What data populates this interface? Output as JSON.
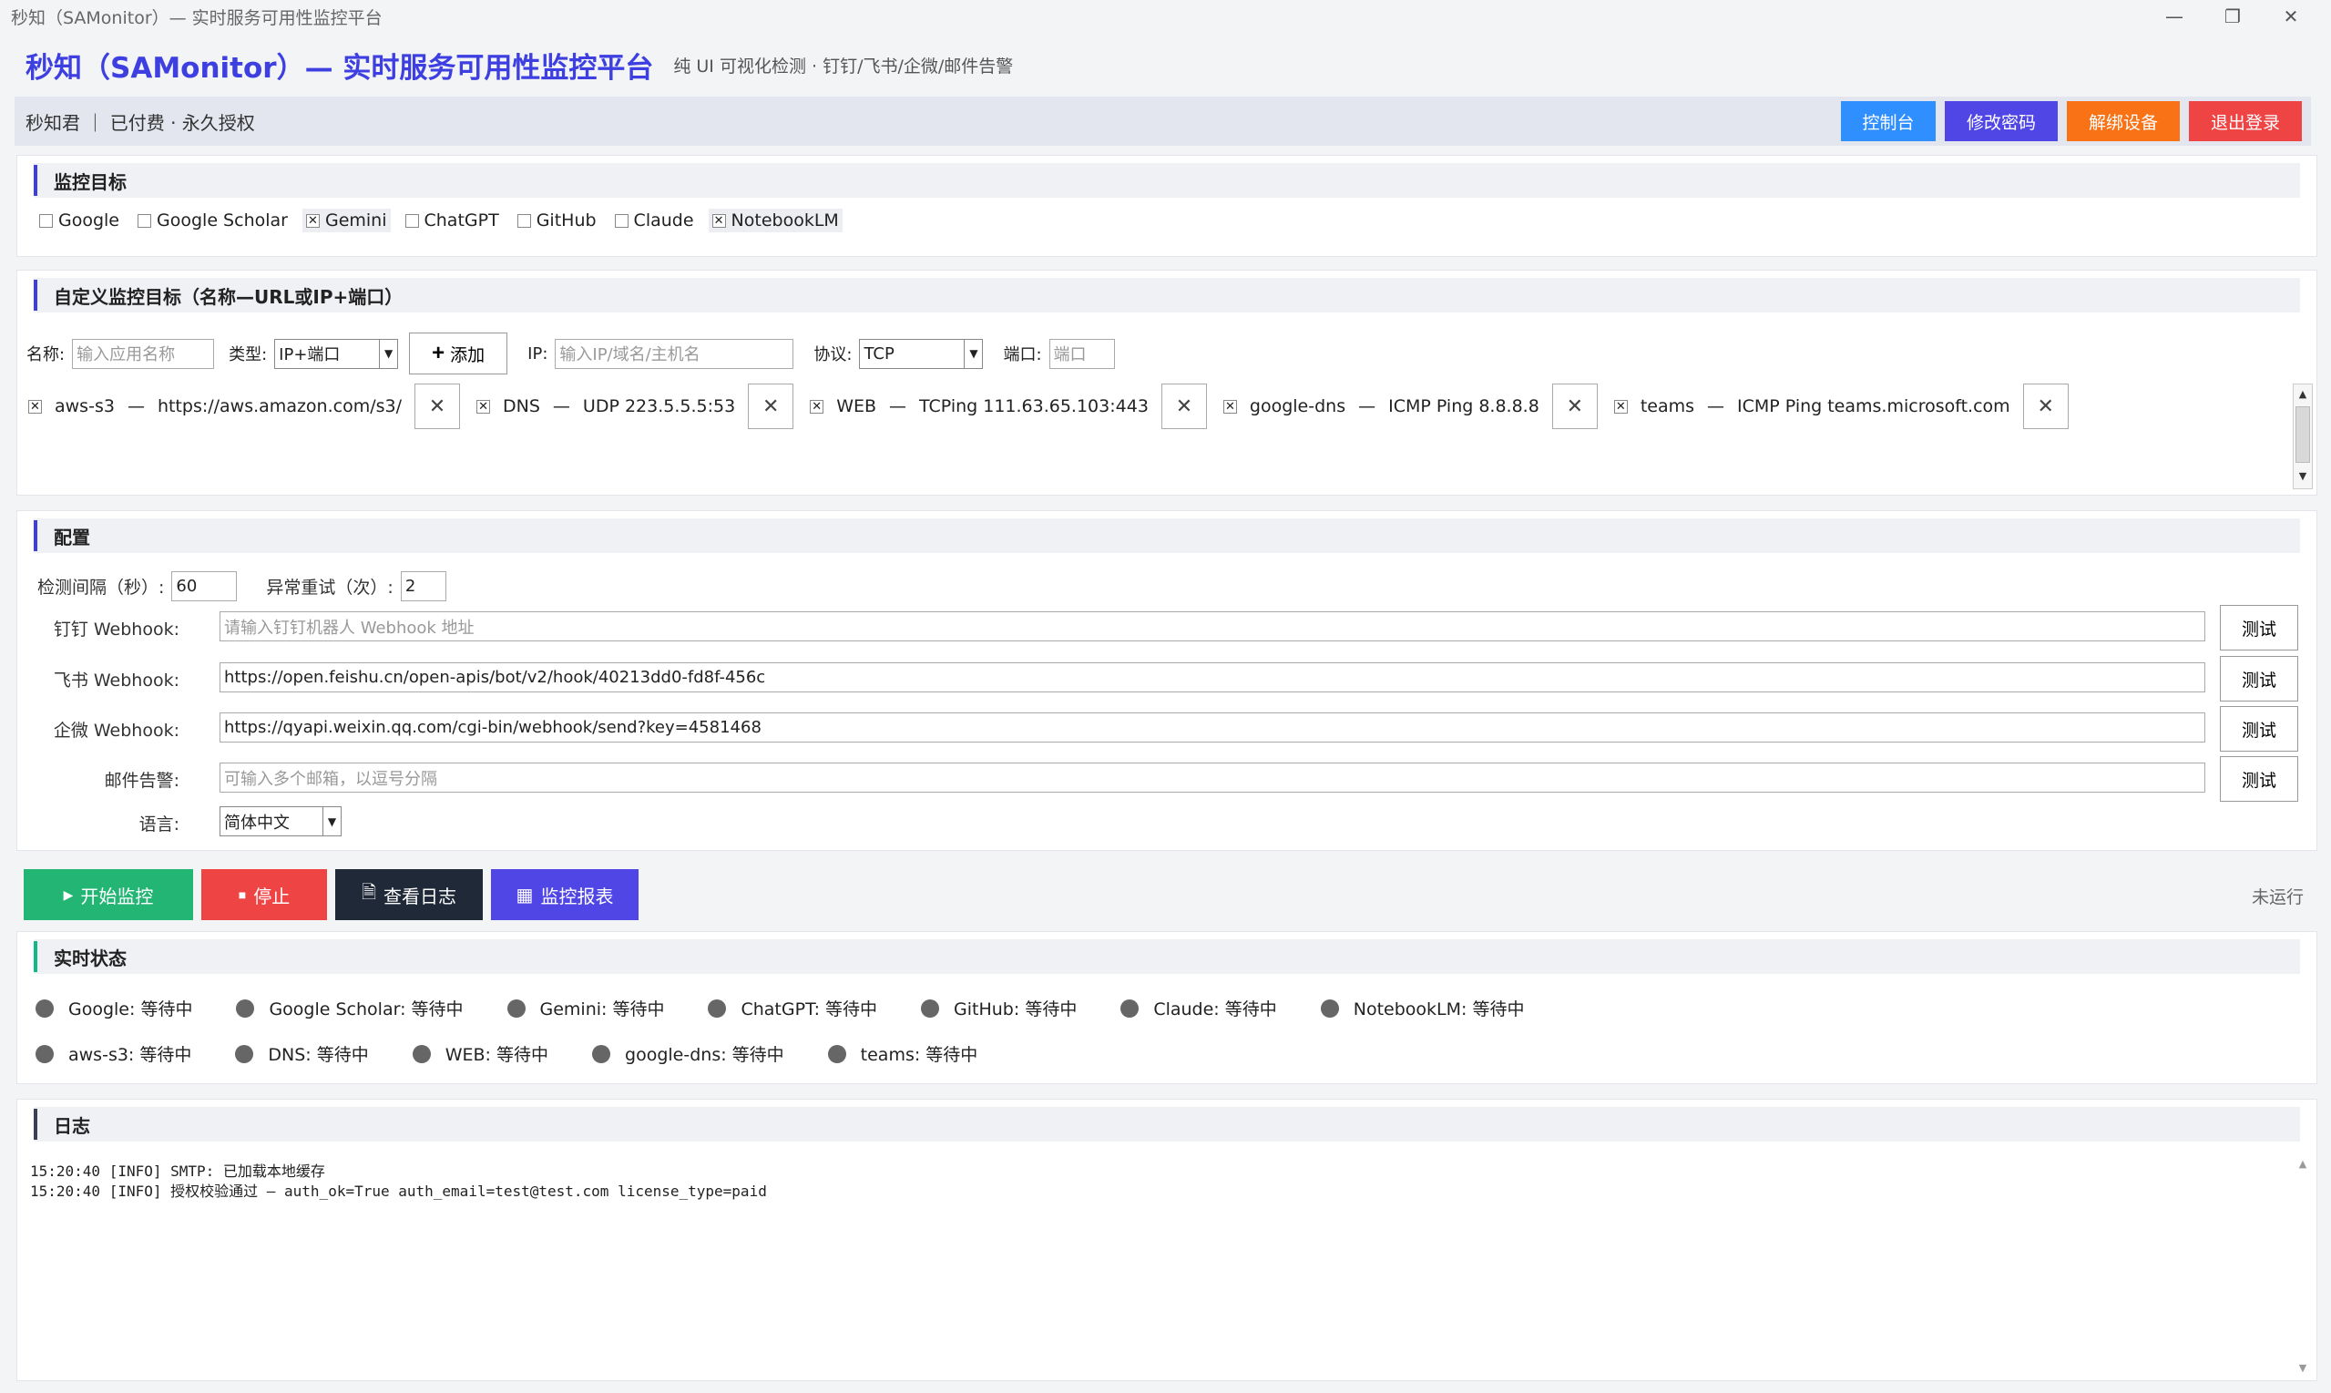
{
  "window": {
    "title": "秒知（SAMonitor）— 实时服务可用性监控平台",
    "controls": [
      "—",
      "❐",
      "✕"
    ]
  },
  "header": {
    "title": "秒知（SAMonitor）— 实时服务可用性监控平台",
    "subtitle": "纯 UI 可视化检测 · 钉钉/飞书/企微/邮件告警"
  },
  "user": {
    "info": "秒知君 ｜ 已付费 · 永久授权",
    "buttons": [
      {
        "label": "控制台",
        "color": "#2f8fff"
      },
      {
        "label": "修改密码",
        "color": "#4f46e5"
      },
      {
        "label": "解绑设备",
        "color": "#f97316"
      },
      {
        "label": "退出登录",
        "color": "#ef4444"
      }
    ]
  },
  "targets": {
    "title": "监控目标",
    "items": [
      {
        "label": "Google",
        "checked": false
      },
      {
        "label": "Google Scholar",
        "checked": false
      },
      {
        "label": "Gemini",
        "checked": true
      },
      {
        "label": "ChatGPT",
        "checked": false
      },
      {
        "label": "GitHub",
        "checked": false
      },
      {
        "label": "Claude",
        "checked": false
      },
      {
        "label": "NotebookLM",
        "checked": true
      }
    ]
  },
  "custom": {
    "title": "自定义监控目标（名称—URL或IP+端口）",
    "name_label": "名称:",
    "name_placeholder": "输入应用名称",
    "type_label": "类型:",
    "type_value": "IP+端口",
    "add_label": "添加",
    "ip_label": "IP:",
    "ip_placeholder": "输入IP/域名/主机名",
    "proto_label": "协议:",
    "proto_value": "TCP",
    "port_label": "端口:",
    "port_placeholder": "端口",
    "sep": "—",
    "tags": [
      {
        "name": "aws-s3",
        "target": "https://aws.amazon.com/s3/"
      },
      {
        "name": "DNS",
        "target": "UDP 223.5.5.5:53"
      },
      {
        "name": "WEB",
        "target": "TCPing 111.63.65.103:443"
      },
      {
        "name": "google-dns",
        "target": "ICMP Ping 8.8.8.8"
      },
      {
        "name": "teams",
        "target": "ICMP Ping teams.microsoft.com"
      }
    ]
  },
  "config": {
    "title": "配置",
    "interval_label": "检测间隔（秒）:",
    "interval_value": "60",
    "retry_label": "异常重试（次）:",
    "retry_value": "2",
    "test_label": "测试",
    "dingtalk_label": "钉钉 Webhook:",
    "dingtalk_placeholder": "请输入钉钉机器人 Webhook 地址",
    "feishu_label": "飞书 Webhook:",
    "feishu_value": "https://open.feishu.cn/open-apis/bot/v2/hook/40213dd0-fd8f-456c",
    "wecom_label": "企微 Webhook:",
    "wecom_value": "https://qyapi.weixin.qq.com/cgi-bin/webhook/send?key=4581468",
    "email_label": "邮件告警:",
    "email_placeholder": "可输入多个邮箱，以逗号分隔",
    "lang_label": "语言:",
    "lang_value": "简体中文"
  },
  "actions": {
    "start": {
      "label": "开始监控",
      "color": "#22b573"
    },
    "stop": {
      "label": "停止",
      "color": "#ef4444"
    },
    "logs": {
      "label": "查看日志",
      "color": "#1f2937"
    },
    "report": {
      "label": "监控报表",
      "color": "#4f46e5"
    },
    "status": "未运行"
  },
  "realtime": {
    "title": "实时状态",
    "row1": [
      "Google: 等待中",
      "Google Scholar: 等待中",
      "Gemini: 等待中",
      "ChatGPT: 等待中",
      "GitHub: 等待中",
      "Claude: 等待中",
      "NotebookLM: 等待中"
    ],
    "row2": [
      "aws-s3: 等待中",
      "DNS: 等待中",
      "WEB: 等待中",
      "google-dns: 等待中",
      "teams: 等待中"
    ]
  },
  "log": {
    "title": "日志",
    "lines": [
      "15:20:40 [INFO] SMTP: 已加载本地缓存",
      "15:20:40 [INFO] 授权校验通过 — auth_ok=True auth_email=test@test.com license_type=paid"
    ]
  }
}
